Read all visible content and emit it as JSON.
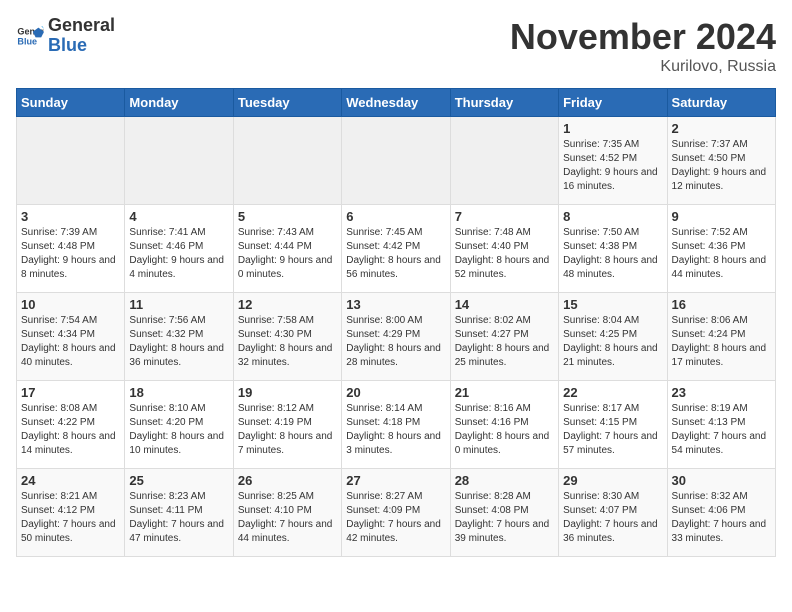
{
  "header": {
    "logo_general": "General",
    "logo_blue": "Blue",
    "month_title": "November 2024",
    "location": "Kurilovo, Russia"
  },
  "weekdays": [
    "Sunday",
    "Monday",
    "Tuesday",
    "Wednesday",
    "Thursday",
    "Friday",
    "Saturday"
  ],
  "weeks": [
    [
      {
        "day": "",
        "info": ""
      },
      {
        "day": "",
        "info": ""
      },
      {
        "day": "",
        "info": ""
      },
      {
        "day": "",
        "info": ""
      },
      {
        "day": "",
        "info": ""
      },
      {
        "day": "1",
        "info": "Sunrise: 7:35 AM\nSunset: 4:52 PM\nDaylight: 9 hours and 16 minutes."
      },
      {
        "day": "2",
        "info": "Sunrise: 7:37 AM\nSunset: 4:50 PM\nDaylight: 9 hours and 12 minutes."
      }
    ],
    [
      {
        "day": "3",
        "info": "Sunrise: 7:39 AM\nSunset: 4:48 PM\nDaylight: 9 hours and 8 minutes."
      },
      {
        "day": "4",
        "info": "Sunrise: 7:41 AM\nSunset: 4:46 PM\nDaylight: 9 hours and 4 minutes."
      },
      {
        "day": "5",
        "info": "Sunrise: 7:43 AM\nSunset: 4:44 PM\nDaylight: 9 hours and 0 minutes."
      },
      {
        "day": "6",
        "info": "Sunrise: 7:45 AM\nSunset: 4:42 PM\nDaylight: 8 hours and 56 minutes."
      },
      {
        "day": "7",
        "info": "Sunrise: 7:48 AM\nSunset: 4:40 PM\nDaylight: 8 hours and 52 minutes."
      },
      {
        "day": "8",
        "info": "Sunrise: 7:50 AM\nSunset: 4:38 PM\nDaylight: 8 hours and 48 minutes."
      },
      {
        "day": "9",
        "info": "Sunrise: 7:52 AM\nSunset: 4:36 PM\nDaylight: 8 hours and 44 minutes."
      }
    ],
    [
      {
        "day": "10",
        "info": "Sunrise: 7:54 AM\nSunset: 4:34 PM\nDaylight: 8 hours and 40 minutes."
      },
      {
        "day": "11",
        "info": "Sunrise: 7:56 AM\nSunset: 4:32 PM\nDaylight: 8 hours and 36 minutes."
      },
      {
        "day": "12",
        "info": "Sunrise: 7:58 AM\nSunset: 4:30 PM\nDaylight: 8 hours and 32 minutes."
      },
      {
        "day": "13",
        "info": "Sunrise: 8:00 AM\nSunset: 4:29 PM\nDaylight: 8 hours and 28 minutes."
      },
      {
        "day": "14",
        "info": "Sunrise: 8:02 AM\nSunset: 4:27 PM\nDaylight: 8 hours and 25 minutes."
      },
      {
        "day": "15",
        "info": "Sunrise: 8:04 AM\nSunset: 4:25 PM\nDaylight: 8 hours and 21 minutes."
      },
      {
        "day": "16",
        "info": "Sunrise: 8:06 AM\nSunset: 4:24 PM\nDaylight: 8 hours and 17 minutes."
      }
    ],
    [
      {
        "day": "17",
        "info": "Sunrise: 8:08 AM\nSunset: 4:22 PM\nDaylight: 8 hours and 14 minutes."
      },
      {
        "day": "18",
        "info": "Sunrise: 8:10 AM\nSunset: 4:20 PM\nDaylight: 8 hours and 10 minutes."
      },
      {
        "day": "19",
        "info": "Sunrise: 8:12 AM\nSunset: 4:19 PM\nDaylight: 8 hours and 7 minutes."
      },
      {
        "day": "20",
        "info": "Sunrise: 8:14 AM\nSunset: 4:18 PM\nDaylight: 8 hours and 3 minutes."
      },
      {
        "day": "21",
        "info": "Sunrise: 8:16 AM\nSunset: 4:16 PM\nDaylight: 8 hours and 0 minutes."
      },
      {
        "day": "22",
        "info": "Sunrise: 8:17 AM\nSunset: 4:15 PM\nDaylight: 7 hours and 57 minutes."
      },
      {
        "day": "23",
        "info": "Sunrise: 8:19 AM\nSunset: 4:13 PM\nDaylight: 7 hours and 54 minutes."
      }
    ],
    [
      {
        "day": "24",
        "info": "Sunrise: 8:21 AM\nSunset: 4:12 PM\nDaylight: 7 hours and 50 minutes."
      },
      {
        "day": "25",
        "info": "Sunrise: 8:23 AM\nSunset: 4:11 PM\nDaylight: 7 hours and 47 minutes."
      },
      {
        "day": "26",
        "info": "Sunrise: 8:25 AM\nSunset: 4:10 PM\nDaylight: 7 hours and 44 minutes."
      },
      {
        "day": "27",
        "info": "Sunrise: 8:27 AM\nSunset: 4:09 PM\nDaylight: 7 hours and 42 minutes."
      },
      {
        "day": "28",
        "info": "Sunrise: 8:28 AM\nSunset: 4:08 PM\nDaylight: 7 hours and 39 minutes."
      },
      {
        "day": "29",
        "info": "Sunrise: 8:30 AM\nSunset: 4:07 PM\nDaylight: 7 hours and 36 minutes."
      },
      {
        "day": "30",
        "info": "Sunrise: 8:32 AM\nSunset: 4:06 PM\nDaylight: 7 hours and 33 minutes."
      }
    ]
  ]
}
